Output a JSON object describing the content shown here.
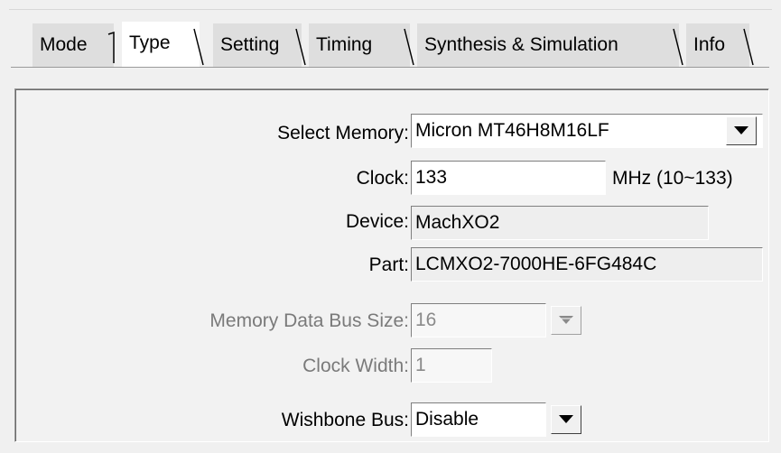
{
  "tabs": [
    {
      "label": "Mode",
      "active": false
    },
    {
      "label": "Type",
      "active": true
    },
    {
      "label": "Setting",
      "active": false
    },
    {
      "label": "Timing",
      "active": false
    },
    {
      "label": "Synthesis & Simulation",
      "active": false
    },
    {
      "label": "Info",
      "active": false
    }
  ],
  "form": {
    "select_memory": {
      "label": "Select Memory:",
      "value": "Micron MT46H8M16LF"
    },
    "clock": {
      "label": "Clock:",
      "value": "133",
      "unit": "MHz (10~133)"
    },
    "device": {
      "label": "Device:",
      "value": "MachXO2"
    },
    "part": {
      "label": "Part:",
      "value": "LCMXO2-7000HE-6FG484C"
    },
    "memory_data_bus_size": {
      "label": "Memory Data Bus Size:",
      "value": "16"
    },
    "clock_width": {
      "label": "Clock Width:",
      "value": "1"
    },
    "wishbone_bus": {
      "label": "Wishbone Bus:",
      "value": "Disable"
    }
  },
  "icons": {
    "dropdown": "chevron-down-icon"
  }
}
